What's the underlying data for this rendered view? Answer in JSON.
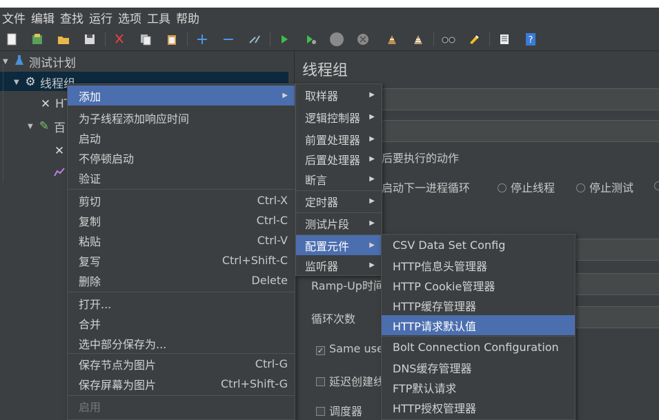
{
  "menubar": [
    "文件",
    "编辑",
    "查找",
    "运行",
    "选项",
    "工具",
    "帮助"
  ],
  "toolbar": {
    "icons": [
      "new-icon",
      "templates-icon",
      "open-icon",
      "save-icon",
      "cut-icon",
      "copy-icon",
      "paste-icon",
      "expand-icon",
      "collapse-icon",
      "toggle-icon",
      "start-icon",
      "start-no-pause-icon",
      "stop-icon",
      "shutdown-icon",
      "clear-icon",
      "clear-all-icon",
      "search-icon",
      "reset-search-icon",
      "function-helper-icon",
      "help-icon"
    ]
  },
  "tree": {
    "items": [
      {
        "label": "测试计划"
      },
      {
        "label": "线程组"
      },
      {
        "label": "HT"
      },
      {
        "label": "百"
      }
    ]
  },
  "panel": {
    "title": "线程组",
    "error_action_label": "后要执行的动作",
    "radio_next_loop": "启动下一进程循环",
    "radio_stop_thread": "停止线程",
    "radio_stop_test": "停止测试",
    "rampup_label": "Ramp-Up时间",
    "loop_label": "循环次数",
    "same_user_label": "Same use",
    "delay_label": "延迟创建线",
    "scheduler_label": "调度器"
  },
  "context_menu": {
    "items": [
      {
        "label": "添加",
        "shortcut": ""
      },
      {
        "label": "为子线程添加响应时间",
        "shortcut": ""
      },
      {
        "label": "启动",
        "shortcut": ""
      },
      {
        "label": "不停顿启动",
        "shortcut": ""
      },
      {
        "label": "验证",
        "shortcut": ""
      },
      {
        "label": "剪切",
        "shortcut": "Ctrl-X"
      },
      {
        "label": "复制",
        "shortcut": "Ctrl-C"
      },
      {
        "label": "粘贴",
        "shortcut": "Ctrl-V"
      },
      {
        "label": "复写",
        "shortcut": "Ctrl+Shift-C"
      },
      {
        "label": "删除",
        "shortcut": "Delete"
      },
      {
        "label": "打开...",
        "shortcut": ""
      },
      {
        "label": "合并",
        "shortcut": ""
      },
      {
        "label": "选中部分保存为...",
        "shortcut": ""
      },
      {
        "label": "保存节点为图片",
        "shortcut": "Ctrl-G"
      },
      {
        "label": "保存屏幕为图片",
        "shortcut": "Ctrl+Shift-G"
      },
      {
        "label": "启用",
        "shortcut": ""
      }
    ]
  },
  "add_submenu": {
    "items": [
      "取样器",
      "逻辑控制器",
      "前置处理器",
      "后置处理器",
      "断言",
      "定时器",
      "测试片段",
      "配置元件",
      "监听器"
    ]
  },
  "config_submenu": {
    "items": [
      "CSV Data Set Config",
      "HTTP信息头管理器",
      "HTTP Cookie管理器",
      "HTTP缓存管理器",
      "HTTP请求默认值",
      "Bolt Connection Configuration",
      "DNS缓存管理器",
      "FTP默认请求",
      "HTTP授权管理器"
    ]
  },
  "colors": {
    "background": "#3c3f41",
    "menu_highlight": "#4b6eaf",
    "tree_selected": "#0d293e"
  }
}
